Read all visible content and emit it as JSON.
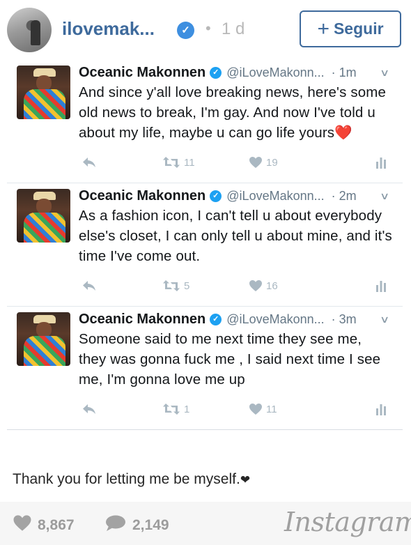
{
  "header": {
    "username": "ilovemak...",
    "dot": "•",
    "time": "1 d",
    "follow_label": "Seguir",
    "follow_plus": "+",
    "accent": "#3e6a9c"
  },
  "tweets": [
    {
      "name": "Oceanic Makonnen",
      "handle": "@iLoveMakonn...",
      "time": "· 1m",
      "text": "And since y'all love breaking news, here's some old news to break, I'm gay. And now I've told u about my life, maybe u can go life yours",
      "emoji": "❤️",
      "retweets": "11",
      "likes": "19"
    },
    {
      "name": "Oceanic Makonnen",
      "handle": "@iLoveMakonn...",
      "time": "· 2m",
      "text": "As a fashion icon, I can't tell u about everybody else's closet, I can only tell u about mine, and it's time I've come out.",
      "emoji": "",
      "retweets": "5",
      "likes": "16"
    },
    {
      "name": "Oceanic Makonnen",
      "handle": "@iLoveMakonn...",
      "time": "· 3m",
      "text": "Someone said to me next time they see me, they was gonna fuck me , I said next time I see me, I'm gonna love me up",
      "emoji": "",
      "retweets": "1",
      "likes": "11"
    }
  ],
  "caption": {
    "text": "Thank you for letting me be myself.",
    "heart": "❤"
  },
  "footer": {
    "likes": "8,867",
    "comments": "2,149",
    "logo": "Instagram"
  }
}
